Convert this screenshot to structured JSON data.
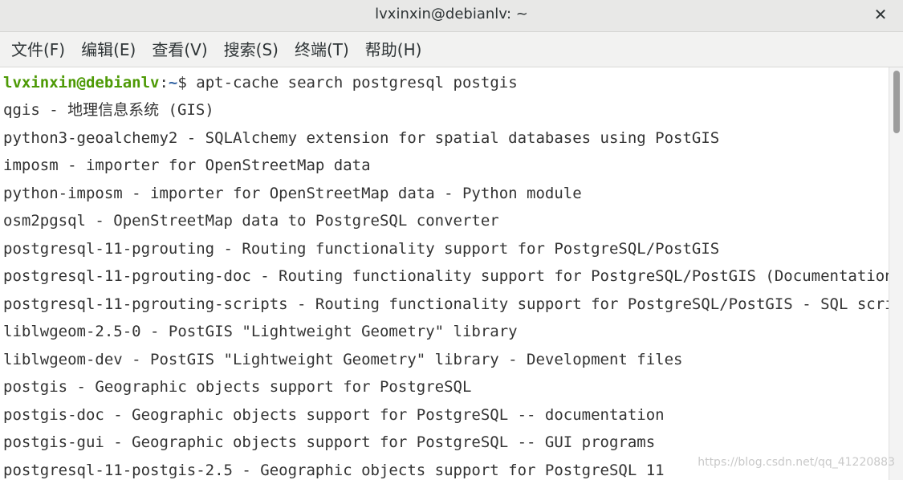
{
  "window": {
    "title": "lvxinxin@debianlv: ~",
    "close_glyph": "✕"
  },
  "menu": [
    {
      "label": "文件(F)"
    },
    {
      "label": "编辑(E)"
    },
    {
      "label": "查看(V)"
    },
    {
      "label": "搜索(S)"
    },
    {
      "label": "终端(T)"
    },
    {
      "label": "帮助(H)"
    }
  ],
  "prompt": {
    "user_host": "lvxinxin@debianlv",
    "separator": ":",
    "path": "~",
    "symbol": "$ ",
    "command": "apt-cache search postgresql postgis"
  },
  "output": [
    "qgis - 地理信息系统 (GIS)",
    "python3-geoalchemy2 - SQLAlchemy extension for spatial databases using PostGIS",
    "imposm - importer for OpenStreetMap data",
    "python-imposm - importer for OpenStreetMap data - Python module",
    "osm2pgsql - OpenStreetMap data to PostgreSQL converter",
    "postgresql-11-pgrouting - Routing functionality support for PostgreSQL/PostGIS",
    "postgresql-11-pgrouting-doc - Routing functionality support for PostgreSQL/PostGIS (Documentation)",
    "postgresql-11-pgrouting-scripts - Routing functionality support for PostgreSQL/PostGIS - SQL scripts",
    "liblwgeom-2.5-0 - PostGIS \"Lightweight Geometry\" library",
    "liblwgeom-dev - PostGIS \"Lightweight Geometry\" library - Development files",
    "postgis - Geographic objects support for PostgreSQL",
    "postgis-doc - Geographic objects support for PostgreSQL -- documentation",
    "postgis-gui - Geographic objects support for PostgreSQL -- GUI programs",
    "postgresql-11-postgis-2.5 - Geographic objects support for PostgreSQL 11"
  ],
  "watermark": "https://blog.csdn.net/qq_41220883",
  "colors": {
    "prompt_user": "#4e9a06",
    "prompt_path": "#3465a4",
    "text": "#333333"
  }
}
